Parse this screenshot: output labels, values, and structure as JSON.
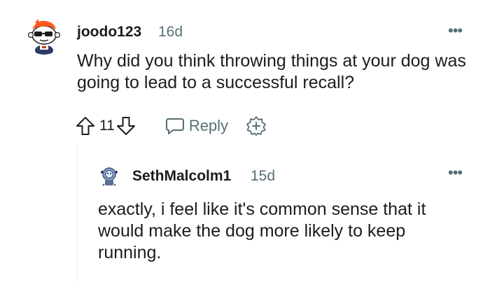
{
  "comments": [
    {
      "username": "joodo123",
      "age": "16d",
      "body": "Why did you think throwing things at your dog was going to lead to a successful recall?",
      "votes": "11",
      "reply_label": "Reply",
      "more_label": "•••",
      "avatar_icon": "snoo-sunglasses-avatar-icon"
    },
    {
      "username": "SethMalcolm1",
      "age": "15d",
      "body": "exactly, i feel like it's common sense that it would make the dog more likely to keep running.",
      "more_label": "•••",
      "avatar_icon": "snoo-diver-avatar-icon"
    }
  ],
  "icons": {
    "upvote": "upvote-arrow-icon",
    "downvote": "downvote-arrow-icon",
    "reply": "speech-bubble-icon",
    "award": "award-plus-icon"
  },
  "colors": {
    "text": "#1c1c1c",
    "meta": "#576f76",
    "thread_line": "#e5ebee"
  }
}
